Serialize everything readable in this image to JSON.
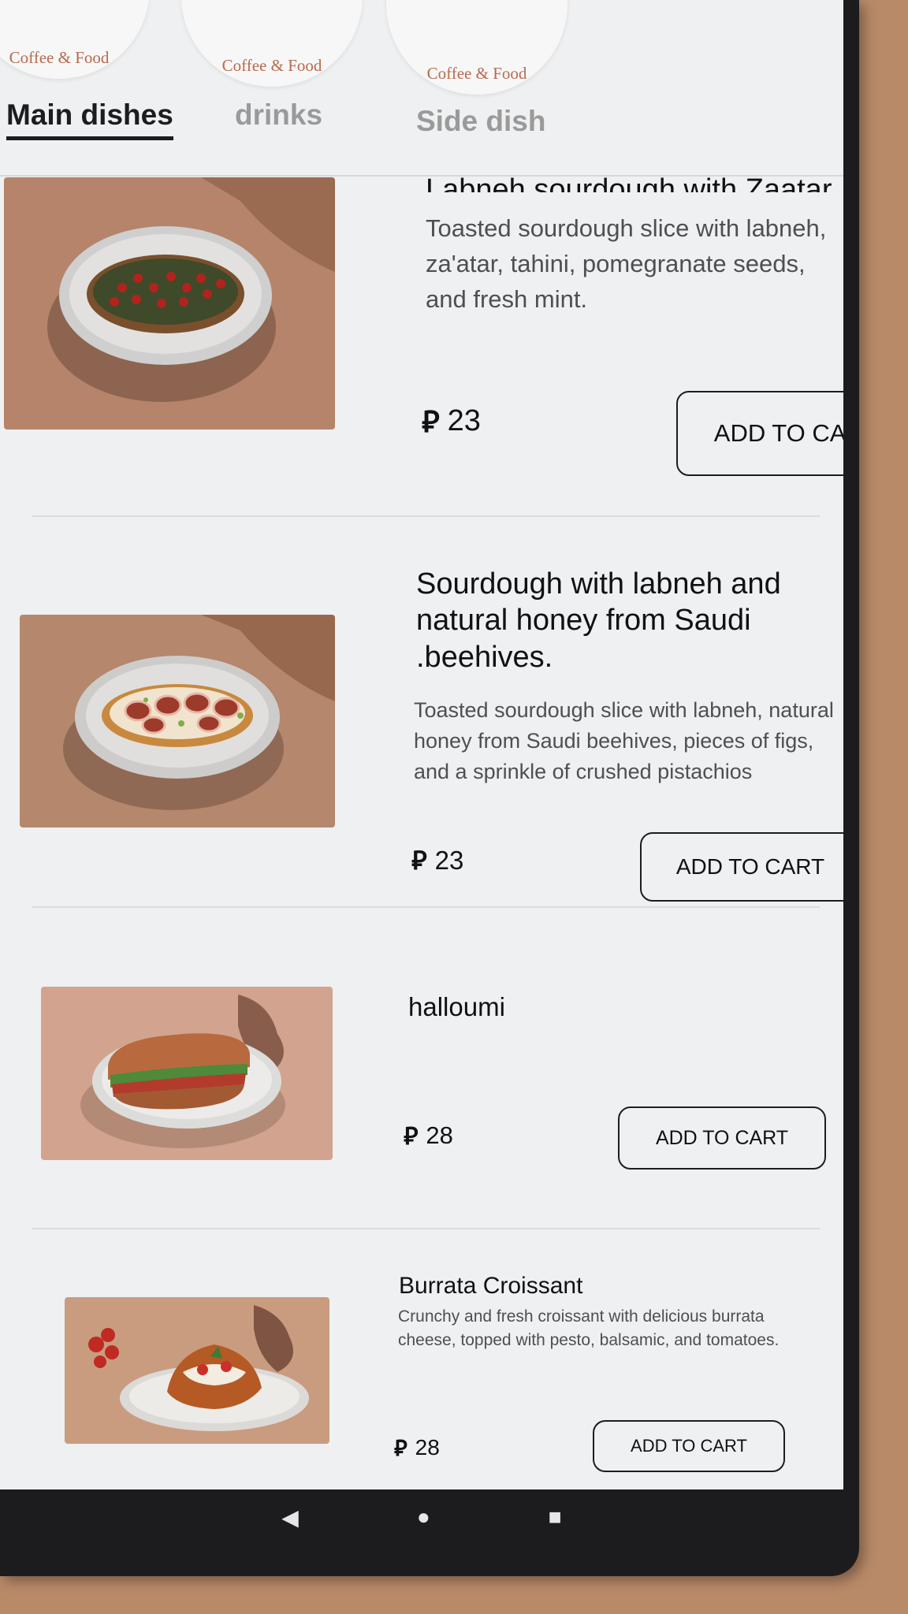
{
  "categories": [
    {
      "label": "Coffee & Food"
    },
    {
      "label": "Coffee & Food"
    },
    {
      "label": "Coffee & Food"
    }
  ],
  "tabs": [
    {
      "label": "Main dishes",
      "active": true
    },
    {
      "label": "drinks",
      "active": false
    },
    {
      "label": "Side dish",
      "active": false
    }
  ],
  "currency_symbol": "⃁",
  "items": [
    {
      "title": "Labneh sourdough with Zaatar",
      "description": "Toasted sourdough slice with labneh, za'atar, tahini, pomegranate seeds, and fresh mint.",
      "price": "23",
      "button": "ADD TO CART"
    },
    {
      "title": "Sourdough with labneh and natural honey from Saudi .beehives.",
      "description": "Toasted sourdough slice with labneh, natural honey from Saudi beehives, pieces of figs, and a sprinkle of crushed pistachios",
      "price": "23",
      "button": "ADD TO CART"
    },
    {
      "title": "halloumi",
      "description": "",
      "price": "28",
      "button": "ADD TO CART"
    },
    {
      "title": "Burrata Croissant",
      "description": "Crunchy and fresh croissant with delicious burrata cheese, topped with pesto, balsamic, and tomatoes.",
      "price": "28",
      "button": "ADD TO CART"
    }
  ],
  "nav": {
    "back": "◀",
    "home": "●",
    "recents": "■"
  },
  "colors": {
    "accent": "#b86a4e",
    "text": "#111111",
    "muted": "#9a9a9a"
  }
}
